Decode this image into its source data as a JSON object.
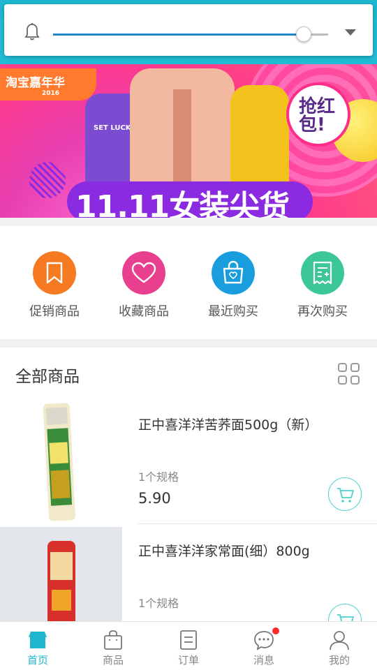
{
  "volume": {
    "level_fraction": 0.91,
    "accent": "#1e88c8",
    "icon": "bell-icon",
    "expand_icon": "chevron-down-icon"
  },
  "banner": {
    "logo_text": "淘宝嘉年华",
    "logo_year": "2016",
    "badge_text": "抢红包!",
    "sweater_print": "SET LUCKY",
    "title": "11.11女装尖货"
  },
  "quick_entries": [
    {
      "label": "促销商品",
      "icon": "bookmark-icon",
      "color": "#f57a22"
    },
    {
      "label": "收藏商品",
      "icon": "heart-icon",
      "color": "#e8408f"
    },
    {
      "label": "最近购买",
      "icon": "shopping-bag-icon",
      "color": "#1a9ddd"
    },
    {
      "label": "再次购买",
      "icon": "receipt-icon",
      "color": "#3cc79a"
    }
  ],
  "products": {
    "section_title": "全部商品",
    "grid_toggle_icon": "grid-icon",
    "items": [
      {
        "name": "正中喜洋洋苦荞面500g（新）",
        "spec": "1个规格",
        "price": "5.90"
      },
      {
        "name": "正中喜洋洋家常面(细）800g",
        "spec": "1个规格",
        "price": ""
      }
    ]
  },
  "tabs": [
    {
      "label": "首页",
      "icon": "home-icon",
      "active": true
    },
    {
      "label": "商品",
      "icon": "bag-icon",
      "active": false
    },
    {
      "label": "订单",
      "icon": "order-icon",
      "active": false
    },
    {
      "label": "消息",
      "icon": "chat-icon",
      "active": false,
      "badge": true
    },
    {
      "label": "我的",
      "icon": "user-icon",
      "active": false
    }
  ],
  "colors": {
    "brand": "#1fb6cf",
    "cart_outline": "#4fd1cc",
    "badge_red": "#ff2a2a"
  }
}
